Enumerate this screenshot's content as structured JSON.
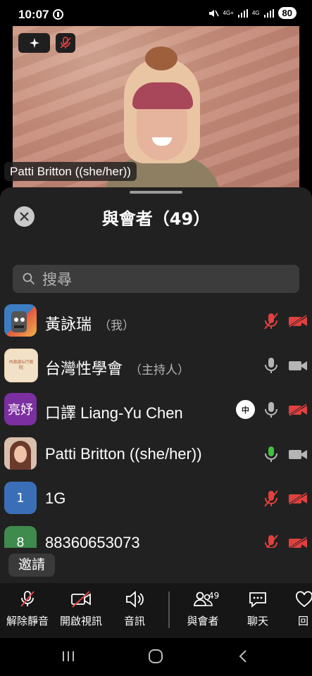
{
  "status": {
    "time": "10:07",
    "battery": "80",
    "net1": "4G+",
    "net2": "4G"
  },
  "video": {
    "speaker_name": "Patti Britton ((she/her))"
  },
  "panel": {
    "title": "與會者（49）",
    "search_placeholder": "搜尋",
    "invite_label": "邀請"
  },
  "participants": [
    {
      "name": "黃詠瑞",
      "role": "（我）",
      "mic": "muted",
      "cam": "off",
      "avatar_color": "#3a7bbf"
    },
    {
      "name": "台灣性學會",
      "role": "（主持人）",
      "mic": "idle",
      "cam": "on",
      "avatar_color": "#f2e1c6",
      "avatar_text": "內政部&行政院"
    },
    {
      "name": "口譯 Liang-Yu Chen",
      "role": "",
      "badge": "中",
      "mic": "idle",
      "cam": "off",
      "avatar_color": "#7b2fa0",
      "avatar_text": "亮妤"
    },
    {
      "name": "Patti Britton ((she/her))",
      "role": "",
      "mic": "active",
      "cam": "on",
      "avatar_color": "#7d4b3b"
    },
    {
      "name": "1G",
      "role": "",
      "mic": "muted",
      "cam": "off",
      "avatar_color": "#3a6fb8",
      "avatar_text": "1"
    },
    {
      "name": "88360653073",
      "role": "",
      "mic": "muted",
      "cam": "off",
      "avatar_color": "#3f8a4d",
      "avatar_text": "8"
    }
  ],
  "toolbar": {
    "unmute": "解除靜音",
    "start_video": "開啟視訊",
    "audio": "音訊",
    "participants": "與會者",
    "participants_count": "49",
    "chat": "聊天",
    "more": "回"
  },
  "colors": {
    "muted_red": "#e0413f",
    "active_green": "#3fbf3f",
    "idle_gray": "#b5b5b5"
  }
}
